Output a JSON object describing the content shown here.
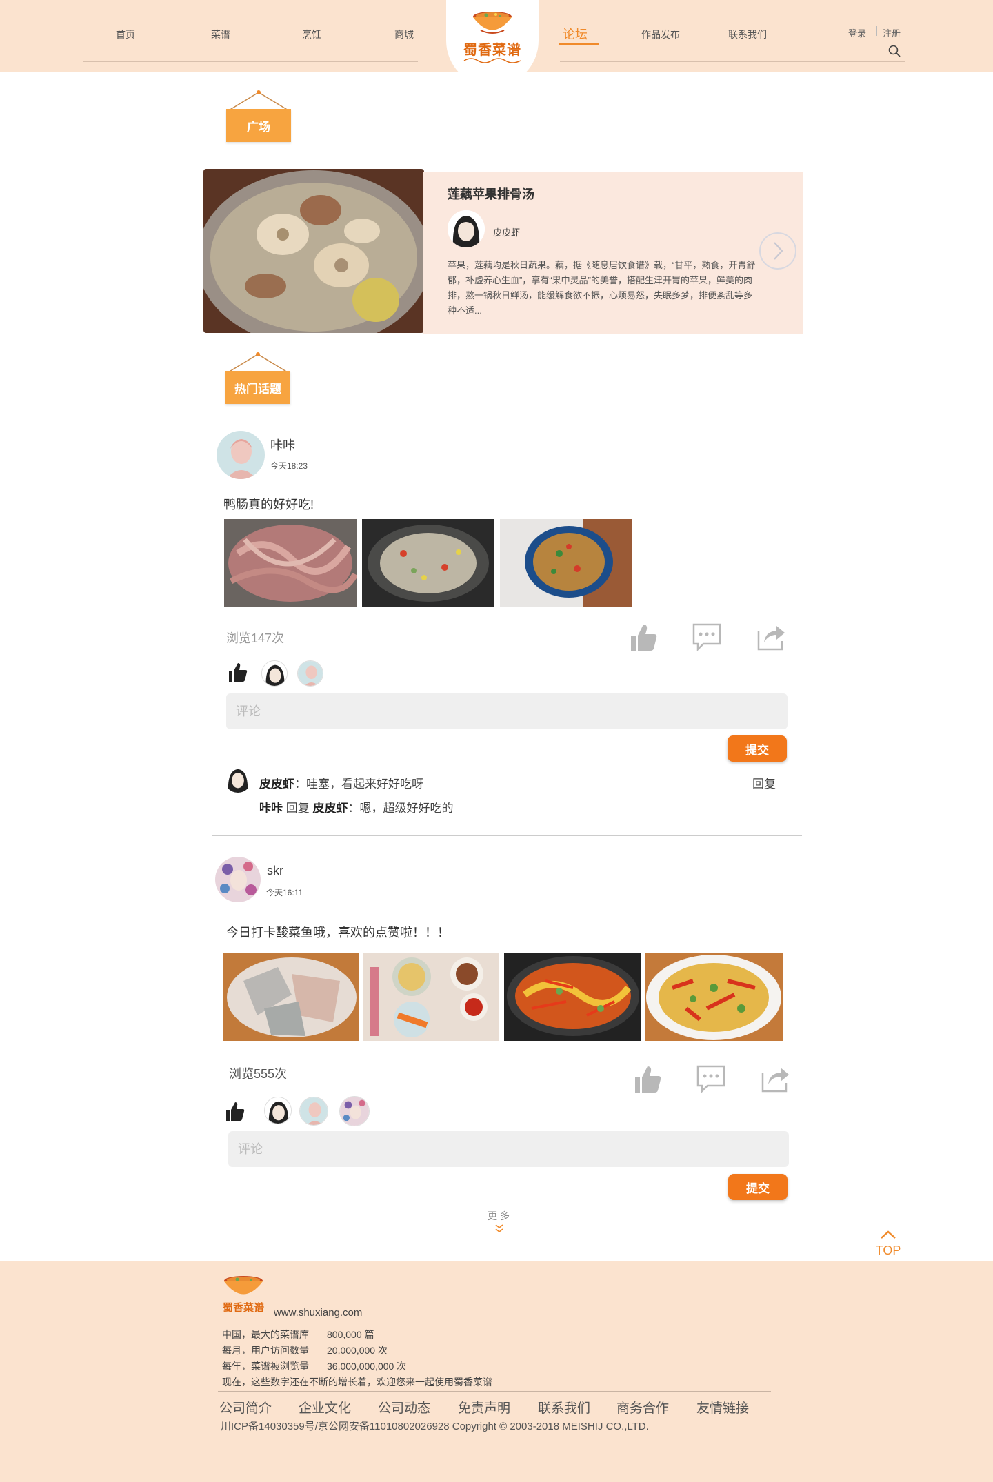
{
  "header": {
    "nav_left": [
      "首页",
      "菜谱",
      "烹饪",
      "商城"
    ],
    "nav_right": [
      "论坛",
      "作品发布",
      "联系我们"
    ],
    "active": "论坛",
    "logo_text": "蜀香菜谱",
    "login": "登录",
    "register": "注册"
  },
  "sections": {
    "square": "广场",
    "hot_topics": "热门话题"
  },
  "featured": {
    "title": "莲藕苹果排骨汤",
    "author": "皮皮虾",
    "description": "苹果，莲藕均是秋日蔬果。藕，据《随息居饮食谱》载，“甘平，熟食，开胃舒郁，补虚养心生血”，享有“果中灵品”的美誉，搭配生津开胃的苹果，鲜美的肉排，熬一锅秋日鲜汤，能缓解食欲不振，心烦易怒，失眠多梦，排便紊乱等多种不适..."
  },
  "posts": [
    {
      "user": "咔咔",
      "time": "今天18:23",
      "text": "鸭肠真的好好吃!",
      "views": "浏览147次",
      "comment_placeholder": "评论",
      "submit": "提交",
      "comments": [
        {
          "author": "皮皮虾",
          "sep": "：",
          "text": "哇塞，看起来好好吃呀",
          "reply_label": "回复"
        },
        {
          "author": "咔咔",
          "verb": "回复",
          "target": "皮皮虾",
          "sep": "：",
          "text": "嗯，超级好好吃的"
        }
      ]
    },
    {
      "user": "skr",
      "time": "今天16:11",
      "text": "今日打卡酸菜鱼哦，喜欢的点赞啦！！！",
      "views": "浏览555次",
      "comment_placeholder": "评论",
      "submit": "提交"
    }
  ],
  "more": "更多",
  "top": "TOP",
  "footer": {
    "logo_text": "蜀香菜谱",
    "url": "www.shuxiang.com",
    "stats": [
      {
        "label": "中国，最大的菜谱库",
        "value": "800,000 篇"
      },
      {
        "label": "每月，用户访问数量",
        "value": "20,000,000 次"
      },
      {
        "label": "每年，菜谱被浏览量",
        "value": "36,000,000,000 次"
      }
    ],
    "note": "现在，这些数字还在不断的增长着，欢迎您来一起使用蜀香菜谱",
    "links": [
      "公司简介",
      "企业文化",
      "公司动态",
      "免责声明",
      "联系我们",
      "商务合作",
      "友情链接"
    ],
    "copyright": "川ICP备14030359号/京公网安备11010802026928 Copyright © 2003-2018 MEISHIJ CO.,LTD."
  },
  "colors": {
    "header_bg": "#fbe3cf",
    "accent": "#f08a2a",
    "tag": "#f7a440",
    "submit": "#f2771a",
    "feature_card": "#fbe8de"
  }
}
